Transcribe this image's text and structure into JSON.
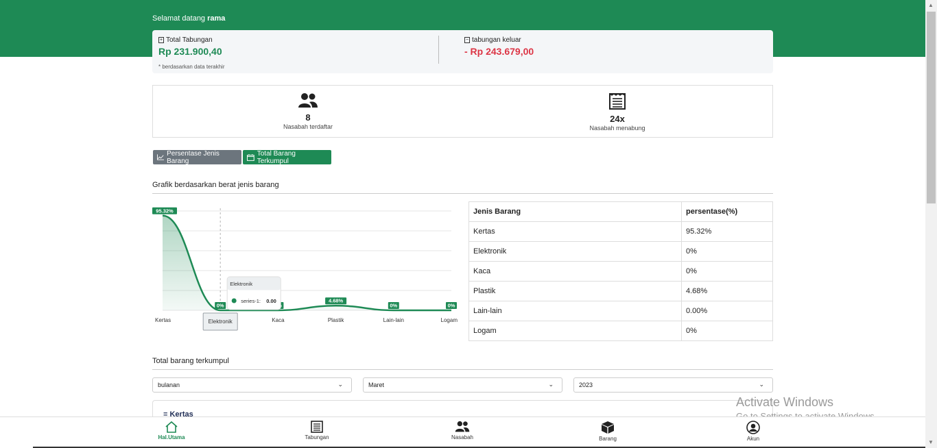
{
  "header": {
    "welcome_prefix": "Selamat datang",
    "username": "rama"
  },
  "balance": {
    "total_label": "Total Tabungan",
    "total_value": "Rp 231.900,40",
    "out_label": "tabungan keluar",
    "out_value": "- Rp 243.679,00",
    "note": "* berdasarkan data terakhir"
  },
  "stats": [
    {
      "value": "8",
      "label": "Nasabah terdaftar",
      "icon": "users-icon"
    },
    {
      "value": "24x",
      "label": "Nasabah menabung",
      "icon": "receipt-icon"
    }
  ],
  "tabs": [
    {
      "label": "Persentase Jenis Barang",
      "icon": "line-chart-icon"
    },
    {
      "label": "Total Barang Terkumpul",
      "icon": "calendar-icon"
    }
  ],
  "chart_section_title": "Grafik berdasarkan berat jenis barang",
  "chart_data": {
    "type": "area",
    "categories": [
      "Kertas",
      "Elektronik",
      "Kaca",
      "Plastik",
      "Lain-lain",
      "Logam"
    ],
    "series": [
      {
        "values": [
          95.32,
          0,
          0,
          4.68,
          0,
          0
        ]
      }
    ],
    "data_labels": [
      "95.32%",
      "0%",
      "0%",
      "4.68%",
      "0%",
      "0%"
    ],
    "ylim": [
      0,
      100
    ],
    "grid": true,
    "color": "#1e8a55",
    "tooltip": {
      "title": "Elektronik",
      "series": "series-1:",
      "value": "0.00"
    }
  },
  "table": {
    "headers": [
      "Jenis Barang",
      "persentase(%)"
    ],
    "rows": [
      [
        "Kertas",
        "95.32%"
      ],
      [
        "Elektronik",
        "0%"
      ],
      [
        "Kaca",
        "0%"
      ],
      [
        "Plastik",
        "4.68%"
      ],
      [
        "Lain-lain",
        "0.00%"
      ],
      [
        "Logam",
        "0%"
      ]
    ]
  },
  "total_section_title": "Total barang terkumpul",
  "filters": {
    "period": "bulanan",
    "month": "Maret",
    "year": "2023"
  },
  "card": {
    "title": "Kertas"
  },
  "nav": [
    {
      "label": "Hal.Utama",
      "icon": "home-icon"
    },
    {
      "label": "Tabungan",
      "icon": "receipt-icon"
    },
    {
      "label": "Nasabah",
      "icon": "users-icon"
    },
    {
      "label": "Barang",
      "icon": "box-icon"
    },
    {
      "label": "Akun",
      "icon": "user-circle-icon"
    }
  ],
  "watermark": {
    "title": "Activate Windows",
    "subtitle": "Go to Settings to activate Windows."
  }
}
